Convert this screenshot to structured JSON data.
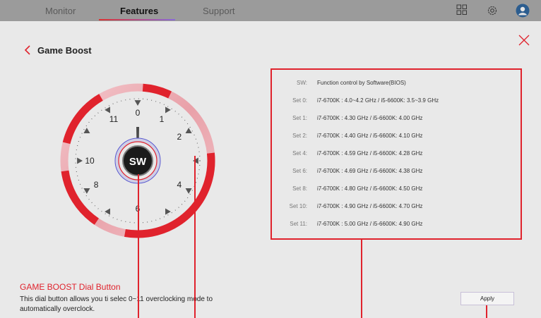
{
  "topbar": {
    "tabs": [
      {
        "label": "Monitor"
      },
      {
        "label": "Features"
      },
      {
        "label": "Support"
      }
    ],
    "icons": [
      "grid-icon",
      "gear-icon",
      "avatar"
    ]
  },
  "page": {
    "title": "Game Boost"
  },
  "dial": {
    "center_label": "SW",
    "numbers": [
      "0",
      "1",
      "2",
      "4",
      "6",
      "8",
      "10",
      "11"
    ]
  },
  "settings": [
    {
      "label": "SW:",
      "desc": "Function control by Software(BIOS)"
    },
    {
      "label": "Set 0:",
      "desc": "i7-6700K : 4.0~4.2 GHz / i5-6600K: 3.5~3.9 GHz"
    },
    {
      "label": "Set 1:",
      "desc": "i7-6700K : 4.30 GHz / i5-6600K: 4.00 GHz"
    },
    {
      "label": "Set 2:",
      "desc": "i7-6700K : 4.40 GHz / i5-6600K: 4.10 GHz"
    },
    {
      "label": "Set 4:",
      "desc": "i7-6700K : 4.59 GHz / i5-6600K: 4.28 GHz"
    },
    {
      "label": "Set 6:",
      "desc": "i7-6700K : 4.69 GHz / i5-6600K: 4.38 GHz"
    },
    {
      "label": "Set 8:",
      "desc": "i7-6700K : 4.80 GHz / i5-6600K: 4.50 GHz"
    },
    {
      "label": "Set 10:",
      "desc": "i7-6700K : 4.90 GHz / i5-6600K: 4.70 GHz"
    },
    {
      "label": "Set 11:",
      "desc": "i7-6700K : 5.00 GHz / i5-6600K: 4.90 GHz"
    }
  ],
  "description": {
    "title": "GAME BOOST Dial Button",
    "text": "This dial button allows you ti selec 0~11 overclocking mode to automatically overclock."
  },
  "actions": {
    "apply_label": "Apply"
  },
  "colors": {
    "accent": "#e0232d",
    "topbar": "#9b9b9b",
    "background": "#e9e9e9"
  }
}
